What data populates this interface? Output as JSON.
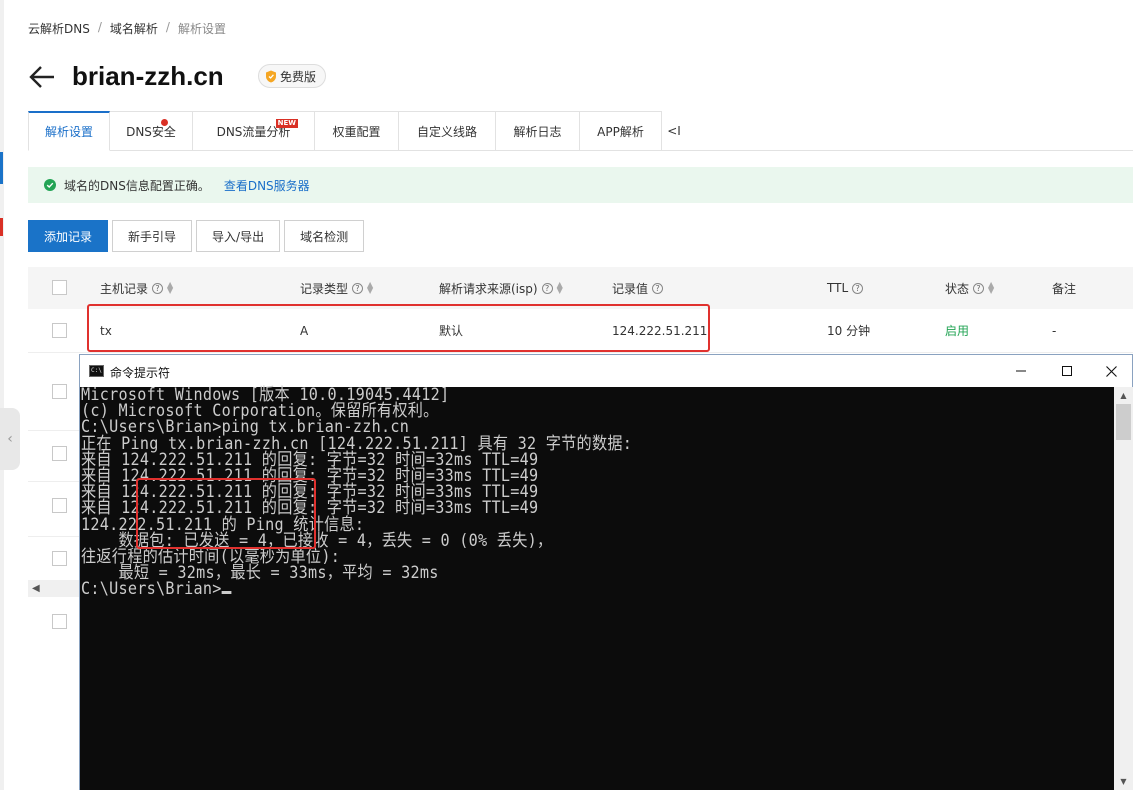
{
  "breadcrumb": [
    "云解析DNS",
    "域名解析",
    "解析设置"
  ],
  "header": {
    "title": "brian-zzh.cn",
    "badge": "免费版"
  },
  "tabs": [
    {
      "label": "解析设置",
      "active": true,
      "dot": false,
      "new": false
    },
    {
      "label": "DNS安全",
      "active": false,
      "dot": true,
      "new": false
    },
    {
      "label": "DNS流量分析",
      "active": false,
      "dot": false,
      "new": true
    },
    {
      "label": "权重配置",
      "active": false,
      "dot": false,
      "new": false
    },
    {
      "label": "自定义线路",
      "active": false,
      "dot": false,
      "new": false
    },
    {
      "label": "解析日志",
      "active": false,
      "dot": false,
      "new": false
    },
    {
      "label": "APP解析",
      "active": false,
      "dot": false,
      "new": false
    }
  ],
  "new_tag": "NEW",
  "tab_more": "<I",
  "alert": {
    "message": "域名的DNS信息配置正确。",
    "link": "查看DNS服务器"
  },
  "toolbar": {
    "add": "添加记录",
    "guide": "新手引导",
    "import_export": "导入/导出",
    "check": "域名检测"
  },
  "table": {
    "columns": [
      "主机记录",
      "记录类型",
      "解析请求来源(isp)",
      "记录值",
      "TTL",
      "状态",
      "备注"
    ],
    "rows": [
      {
        "host": "tx",
        "type": "A",
        "isp": "默认",
        "value": "124.222.51.211",
        "ttl": "10 分钟",
        "status": "启用",
        "remark": "-"
      }
    ]
  },
  "cmd": {
    "title": "命令提示符",
    "lines": [
      "Microsoft Windows [版本 10.0.19045.4412]",
      "(c) Microsoft Corporation。保留所有权利。",
      "",
      "C:\\Users\\Brian>ping tx.brian-zzh.cn",
      "",
      "正在 Ping tx.brian-zzh.cn [124.222.51.211] 具有 32 字节的数据:",
      "来自 124.222.51.211 的回复: 字节=32 时间=32ms TTL=49",
      "来自 124.222.51.211 的回复: 字节=32 时间=33ms TTL=49",
      "来自 124.222.51.211 的回复: 字节=32 时间=33ms TTL=49",
      "来自 124.222.51.211 的回复: 字节=32 时间=33ms TTL=49",
      "",
      "124.222.51.211 的 Ping 统计信息:",
      "    数据包: 已发送 = 4，已接收 = 4，丢失 = 0 (0% 丢失)，",
      "往返行程的估计时间(以毫秒为单位):",
      "    最短 = 32ms，最长 = 33ms，平均 = 32ms",
      "",
      "C:\\Users\\Brian>"
    ]
  },
  "colors": {
    "accent": "#1a73c8",
    "highlight": "#e0312e",
    "success": "#23a455",
    "console_bg": "#0c0c0c"
  }
}
